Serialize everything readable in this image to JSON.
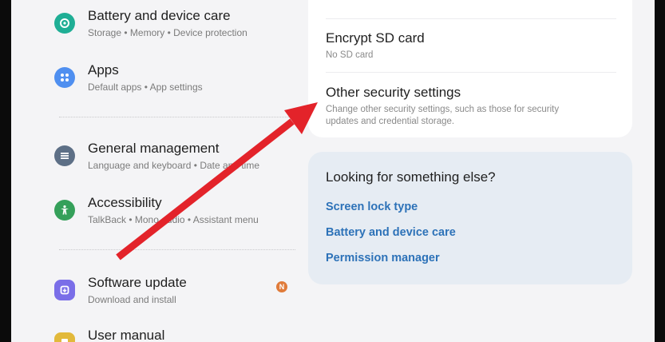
{
  "settings_list": [
    {
      "title": "Battery and device care",
      "subtitle": "Storage  •  Memory  •  Device protection",
      "icon": "battery-care-icon",
      "color": "#1fae95"
    },
    {
      "title": "Apps",
      "subtitle": "Default apps  •  App settings",
      "icon": "apps-icon",
      "color": "#4f8ff0"
    },
    {
      "title": "General management",
      "subtitle": "Language and keyboard  •  Date and time",
      "icon": "general-management-icon",
      "color": "#5d6f86"
    },
    {
      "title": "Accessibility",
      "subtitle": "TalkBack  •  Mono audio  •  Assistant menu",
      "icon": "accessibility-icon",
      "color": "#35a05a"
    },
    {
      "title": "Software update",
      "subtitle": "Download and install",
      "icon": "software-update-icon",
      "color": "#7a6ee8",
      "badge": "N"
    },
    {
      "title": "User manual",
      "subtitle": "",
      "icon": "user-manual-icon",
      "color": "#e2b93b"
    }
  ],
  "security_card": {
    "encrypt": {
      "title": "Encrypt SD card",
      "subtitle": "No SD card"
    },
    "other": {
      "title": "Other security settings",
      "subtitle_line1": "Change other security settings, such as those for security",
      "subtitle_line2": "updates and credential storage."
    }
  },
  "looking_for": {
    "title": "Looking for something else?",
    "links": [
      "Screen lock type",
      "Battery and device care",
      "Permission manager"
    ]
  },
  "colors": {
    "arrow": "#e3232a",
    "link": "#2d72b8",
    "badge": "#e07b3a"
  }
}
